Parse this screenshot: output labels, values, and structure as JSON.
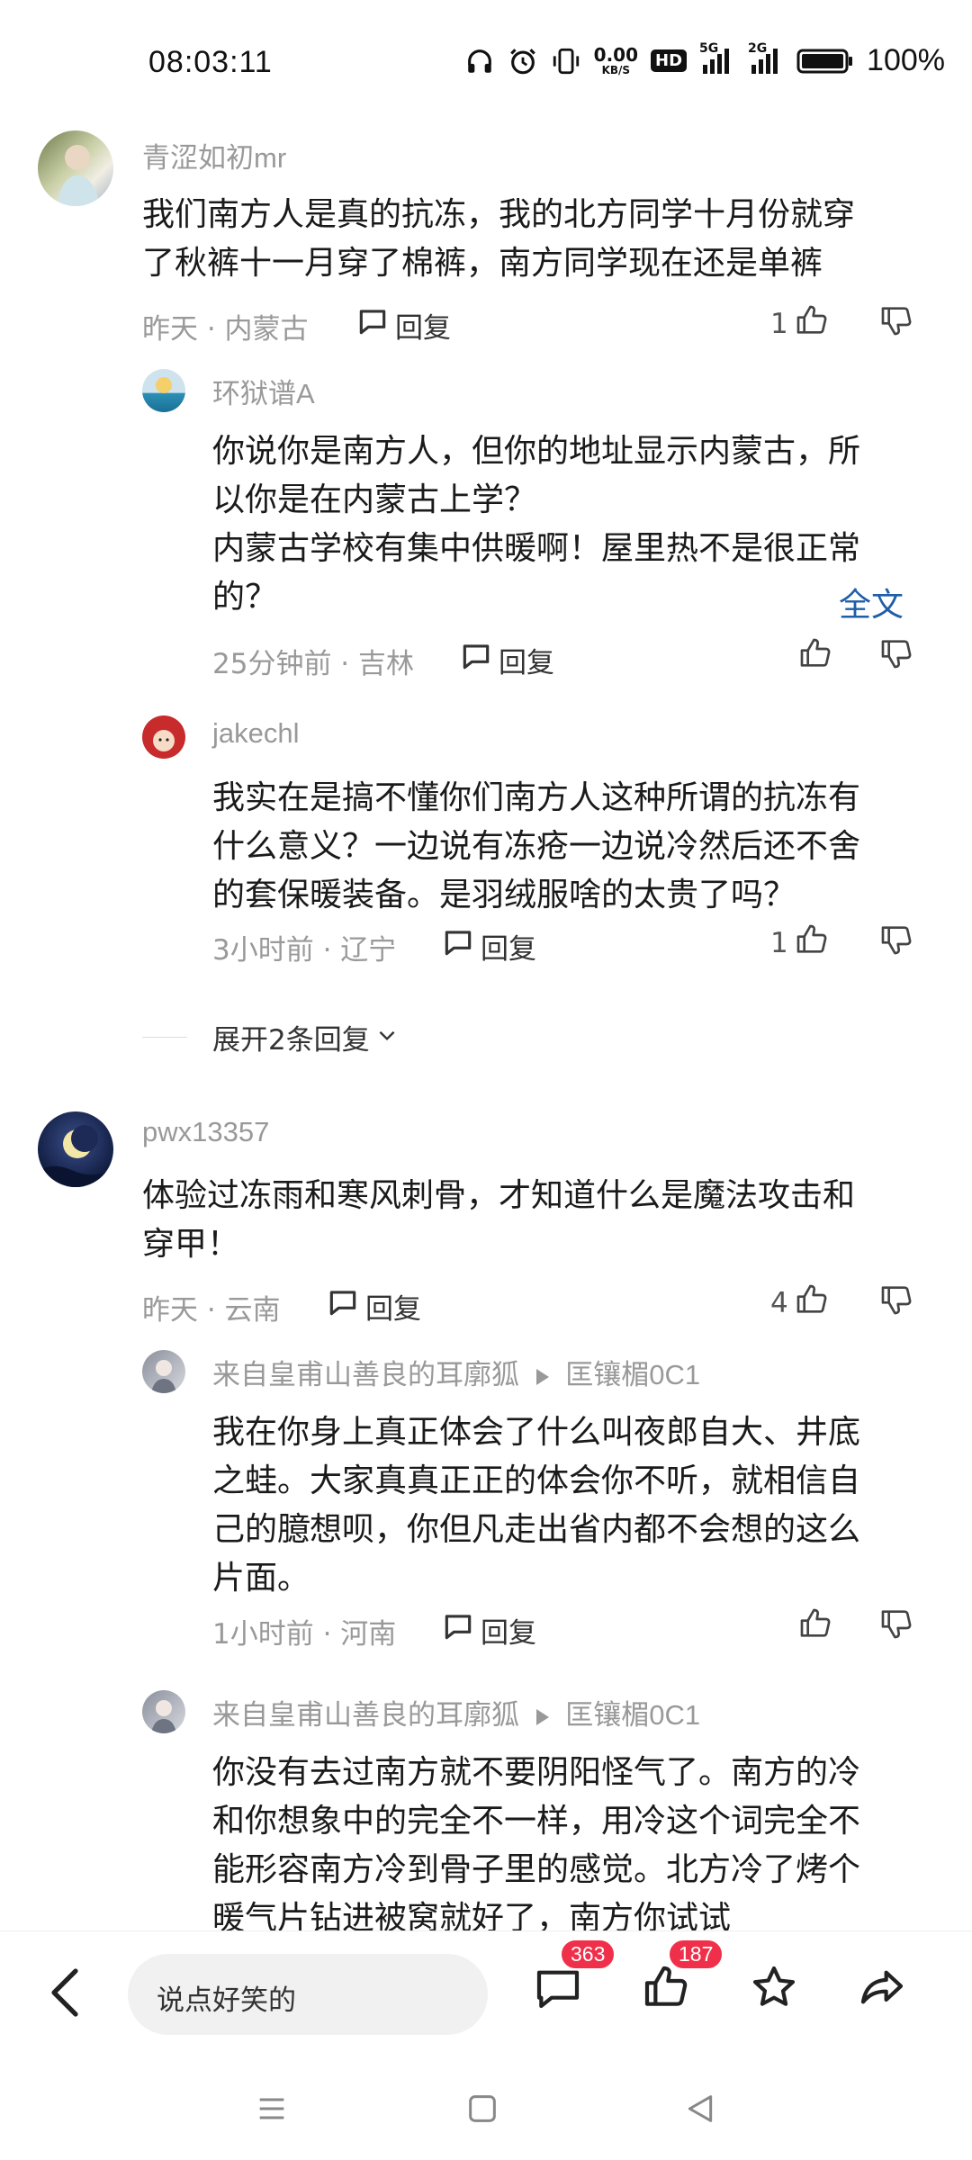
{
  "status_bar": {
    "time": "08:03:11",
    "net_speed_value": "0.00",
    "net_speed_unit": "KB/S",
    "hd_label": "HD",
    "net1": "5G",
    "net2": "2G",
    "battery": "100%"
  },
  "comments": [
    {
      "author": "青涩如初mr",
      "text_lines": [
        "我们南方人是真的抗冻，我的北方同学十月份就穿",
        "了秋裤十一月穿了棉裤，南方同学现在还是单裤"
      ],
      "meta": "昨天 · 内蒙古",
      "reply_label": "回复",
      "likes": "1"
    },
    {
      "author": "环狱谱A",
      "text_lines": [
        "你说你是南方人，但你的地址显示内蒙古，所",
        "以你是在内蒙古上学？",
        "内蒙古学校有集中供暖啊！屋里热不是很正常",
        "的？"
      ],
      "fulltext": "全文",
      "meta": "25分钟前 · 吉林",
      "reply_label": "回复",
      "likes": ""
    },
    {
      "author": "jakechl",
      "text_lines": [
        "我实在是搞不懂你们南方人这种所谓的抗冻有",
        "什么意义？一边说有冻疮一边说冷然后还不舍",
        "的套保暖装备。是羽绒服啥的太贵了吗？"
      ],
      "meta": "3小时前 · 辽宁",
      "reply_label": "回复",
      "likes": "1"
    },
    {
      "expand_label": "展开2条回复"
    },
    {
      "author": "pwx13357",
      "text_lines": [
        "体验过冻雨和寒风刺骨，才知道什么是魔法攻击和",
        "穿甲！"
      ],
      "meta": "昨天 · 云南",
      "reply_label": "回复",
      "likes": "4"
    },
    {
      "author": "来自皇甫山善良的耳廓狐",
      "reply_to": "匡镶楣0C1",
      "text_lines": [
        "我在你身上真正体会了什么叫夜郎自大、井底",
        "之蛙。大家真真正正的体会你不听，就相信自",
        "己的臆想呗，你但凡走出省内都不会想的这么",
        "片面。"
      ],
      "meta": "1小时前 · 河南",
      "reply_label": "回复",
      "likes": ""
    },
    {
      "author": "来自皇甫山善良的耳廓狐",
      "reply_to": "匡镶楣0C1",
      "text_lines": [
        "你没有去过南方就不要阴阳怪气了。南方的冷",
        "和你想象中的完全不一样，用冷这个词完全不",
        "能形容南方冷到骨子里的感觉。北方冷了烤个",
        "暖气片钻进被窝就好了，南方你试试"
      ]
    }
  ],
  "bottom_bar": {
    "input_placeholder": "说点好笑的",
    "comment_count": "363",
    "like_count": "187"
  },
  "colors": {
    "accent_link": "#1f5ea8",
    "badge": "#f0304a",
    "meta_gray": "#999999"
  }
}
